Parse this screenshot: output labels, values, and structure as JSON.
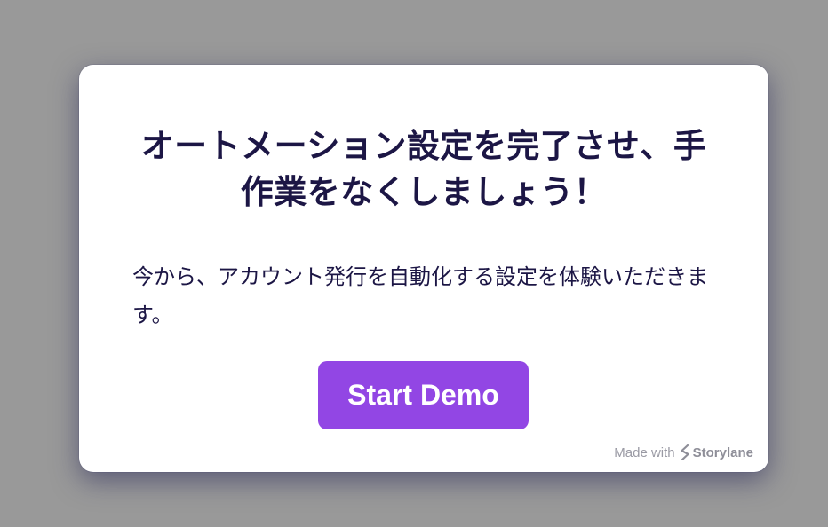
{
  "modal": {
    "title": "オートメーション設定を完了させ、手作業をなくしましょう！",
    "description": "今から、アカウント発行を自動化する設定を体験いただきます。",
    "start_button_label": "Start Demo"
  },
  "branding": {
    "made_with": "Made with",
    "brand": "Storylane",
    "logo_icon": "storylane-logo-icon"
  },
  "colors": {
    "backdrop": "#999999",
    "card": "#ffffff",
    "heading_text": "#1c1645",
    "button": "#9246e4",
    "branding_text": "#9a9aa4"
  }
}
